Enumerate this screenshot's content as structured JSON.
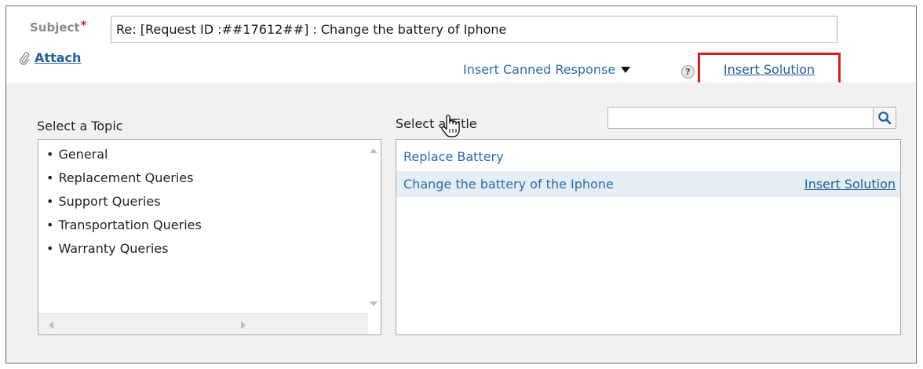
{
  "subject": {
    "label": "Subject",
    "required_mark": "*",
    "value": "Re: [Request ID :##17612##] : Change the battery of Iphone"
  },
  "attach": {
    "label": "Attach",
    "icon": "paperclip-icon"
  },
  "toolbar": {
    "canned_response_label": "Insert Canned Response",
    "help_icon": "question-mark-icon",
    "help_glyph": "?",
    "insert_solution_label": "Insert Solution",
    "highlight_color": "#e01b1b"
  },
  "topics": {
    "label": "Select a Topic",
    "items": [
      {
        "label": "General"
      },
      {
        "label": "Replacement Queries"
      },
      {
        "label": "Support Queries"
      },
      {
        "label": "Transportation Queries"
      },
      {
        "label": "Warranty Queries"
      }
    ]
  },
  "titles": {
    "label": "Select a Title",
    "search_value": "",
    "search_icon": "magnifier-icon",
    "items": [
      {
        "label": "Replace Battery",
        "action": ""
      },
      {
        "label": "Change the battery of the Iphone",
        "action": "Insert Solution",
        "highlighted": true
      }
    ]
  },
  "colors": {
    "link": "#1f5f99",
    "panel_background": "#f1f1f1",
    "row_highlight": "#e5eef5",
    "required": "#e02020"
  }
}
